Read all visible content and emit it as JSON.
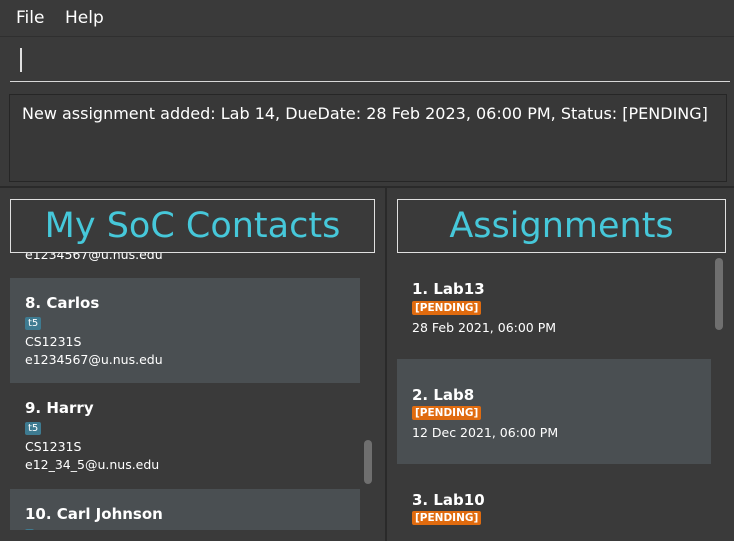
{
  "menu": {
    "file": "File",
    "help": "Help"
  },
  "command": {
    "value": ""
  },
  "result": {
    "text": "New assignment added: Lab 14, DueDate: 28 Feb 2023, 06:00 PM, Status: [PENDING]"
  },
  "contacts": {
    "title": "My SoC Contacts",
    "partial_email": "e1234567@u.nus.edu",
    "items": [
      {
        "title": "8.  Carlos",
        "tag": "t5",
        "module": "CS1231S",
        "email": "e1234567@u.nus.edu"
      },
      {
        "title": "9.  Harry",
        "tag": "t5",
        "module": "CS1231S",
        "email": "e12_34_5@u.nus.edu"
      },
      {
        "title": "10.  Carl Johnson"
      }
    ]
  },
  "assignments": {
    "title": "Assignments",
    "items": [
      {
        "title": "1.  Lab13",
        "status": "[PENDING]",
        "due": "28 Feb 2021, 06:00 PM"
      },
      {
        "title": "2.  Lab8",
        "status": "[PENDING]",
        "due": "12 Dec 2021, 06:00 PM"
      },
      {
        "title": "3.  Lab10",
        "status": "[PENDING]"
      }
    ]
  },
  "colors": {
    "title_accent": "#46c8da",
    "status_badge": "#e06b0f",
    "tag_badge": "#3e7b91"
  }
}
